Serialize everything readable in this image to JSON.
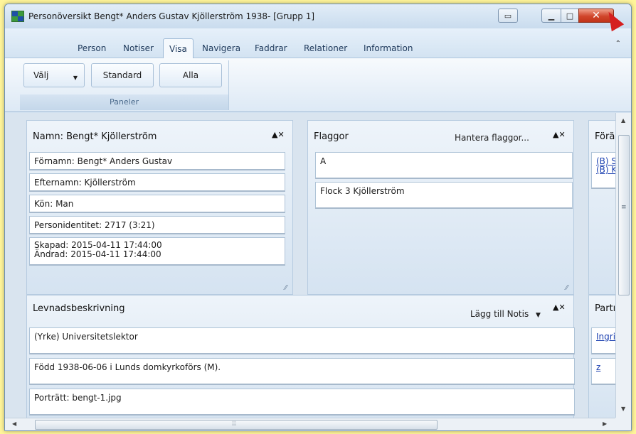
{
  "window": {
    "title": "Personöversikt Bengt* Anders Gustav Kjöllerström 1938- [Grupp 1]",
    "close_glyph": "✕"
  },
  "ribbon": {
    "tabs": [
      "Person",
      "Notiser",
      "Visa",
      "Navigera",
      "Faddrar",
      "Relationer",
      "Information"
    ],
    "active_tab": "Visa",
    "buttons": {
      "valj": "Välj",
      "standard": "Standard",
      "alla": "Alla"
    },
    "group_label": "Paneler"
  },
  "panels": {
    "namn": {
      "title": "Namn: Bengt* Kjöllerström",
      "fields": [
        "Förnamn: Bengt* Anders Gustav",
        "Efternamn: Kjöllerström",
        "Kön: Man",
        "Personidentitet: 2717 (3:21)"
      ],
      "skapad": "Skapad: 2015-04-11 17:44:00",
      "andrad": "Ändrad: 2015-04-11 17:44:00"
    },
    "flaggor": {
      "title": "Flaggor",
      "action": "Hantera flaggor...",
      "items": [
        "A",
        "Flock 3 Kjöllerström"
      ]
    },
    "foraldrar": {
      "title": "Förä",
      "links": [
        "(B) S",
        "(B) K"
      ]
    },
    "levnad": {
      "title": "Levnadsbeskrivning",
      "action": "Lägg till Notis",
      "items": [
        "(Yrke) Universitetslektor",
        "Född 1938-06-06 i Lunds domkyrkoförs (M).",
        "Porträtt: bengt-1.jpg"
      ]
    },
    "partner": {
      "title": "Partı",
      "links": [
        "Ingri",
        "z"
      ]
    }
  },
  "panel_controls": "▲✕"
}
